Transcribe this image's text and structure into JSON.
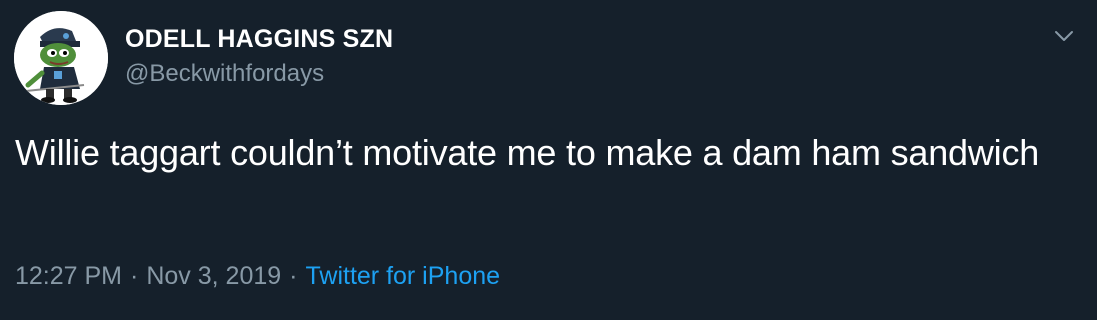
{
  "tweet": {
    "author": {
      "display_name": "ODELL HAGGINS SZN",
      "handle": "@Beckwithfordays"
    },
    "text": "Willie taggart couldn’t motivate me to make a dam ham sandwich",
    "time": "12:27 PM",
    "date": "Nov 3, 2019",
    "separator": "·",
    "source": "Twitter for iPhone"
  },
  "colors": {
    "background": "#15202b",
    "primary_text": "#ffffff",
    "secondary_text": "#8899a6",
    "link": "#1da1f2"
  },
  "icons": {
    "avatar": "pepe-frog-avatar",
    "menu": "chevron-down-icon"
  }
}
